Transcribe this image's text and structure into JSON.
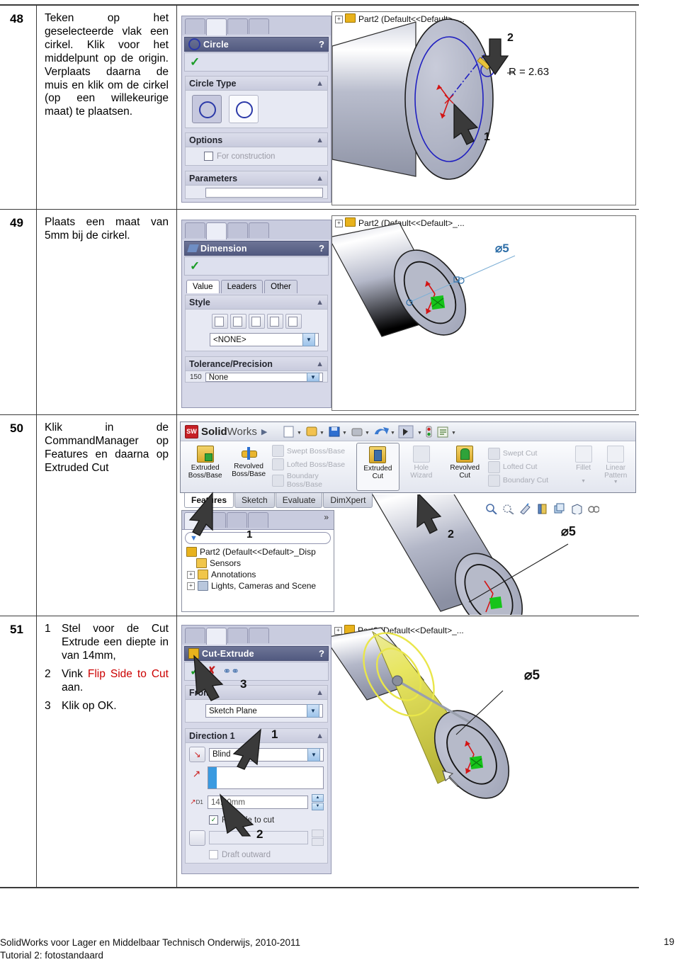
{
  "document": {
    "footer_line1": "SolidWorks voor Lager en Middelbaar Technisch Onderwijs, 2010-2011",
    "footer_line2": "Tutorial 2: fotostandaard",
    "page_number": "19"
  },
  "colors": {
    "accent_red": "#cc0000",
    "panel_title": "#5a6288",
    "dimension_blue": "#2f6fa8",
    "highlight_yellow": "#e9e64a"
  },
  "steps": [
    {
      "number": "48",
      "text": "Teken op het geselecteerde vlak een cirkel. Klik voor het middelpunt op de origin. Verplaats daarna de muis en klik om de cirkel (op een willekeurige maat) te plaatsen.",
      "panel": {
        "title": "Circle",
        "help": "?",
        "groups": [
          {
            "label": "Circle Type"
          },
          {
            "label": "Options",
            "checkbox": "For construction"
          },
          {
            "label": "Parameters"
          }
        ]
      },
      "viewport": {
        "tree_label": "Part2  (Default<<Default>_...",
        "annotations": [
          "1",
          "2"
        ],
        "radius_label": "R = 2.63"
      }
    },
    {
      "number": "49",
      "text": "Plaats een maat van 5mm bij de cirkel.",
      "panel": {
        "title": "Dimension",
        "help": "?",
        "tabs": [
          "Value",
          "Leaders",
          "Other"
        ],
        "groups": [
          {
            "label": "Style",
            "select_value": "<NONE>"
          },
          {
            "label": "Tolerance/Precision",
            "select_value": "None",
            "prefix": "150"
          }
        ]
      },
      "viewport": {
        "tree_label": "Part2  (Default<<Default>_...",
        "dimension_label": "⌀5"
      }
    },
    {
      "number": "50",
      "text": "Klik in de CommandManager op Features en daarna op Extruded Cut",
      "ribbon": {
        "brand": "SolidWorks",
        "brand_bold": "Solid",
        "brand_light": "Works",
        "logo_text": "SW",
        "buttons": [
          {
            "label": "Extruded\nBoss/Base",
            "enabled": true
          },
          {
            "label": "Revolved\nBoss/Base",
            "enabled": true
          },
          {
            "label": "Extruded\nCut",
            "enabled": true,
            "selected": true
          },
          {
            "label": "Hole\nWizard",
            "enabled": false
          },
          {
            "label": "Revolved\nCut",
            "enabled": true
          },
          {
            "label": "Fillet",
            "enabled": false
          },
          {
            "label": "Linear\nPattern",
            "enabled": false
          }
        ],
        "small_buttons_left": [
          "Swept Boss/Base",
          "Lofted Boss/Base",
          "Boundary Boss/Base"
        ],
        "small_buttons_right": [
          "Swept Cut",
          "Lofted Cut",
          "Boundary Cut"
        ],
        "tabs": [
          "Features",
          "Sketch",
          "Evaluate",
          "DimXpert"
        ],
        "active_tab": "Features"
      },
      "tree": {
        "root": "Part2  (Default<<Default>_Disp",
        "items": [
          "Sensors",
          "Annotations",
          "Lights, Cameras and Scene"
        ],
        "overflow": "»"
      },
      "viewport": {
        "annotations": [
          "1",
          "2"
        ],
        "dimension_label": "⌀5"
      }
    },
    {
      "number": "51",
      "substeps": [
        {
          "n": "1",
          "text": "Stel voor de Cut Extrude een diepte in van 14mm,"
        },
        {
          "n": "2",
          "text_before": "Vink ",
          "text_red": "Flip Side to Cut",
          "text_after": " aan."
        },
        {
          "n": "3",
          "text": "Klik op OK."
        }
      ],
      "panel": {
        "title": "Cut-Extrude",
        "help": "?",
        "from_group": "From",
        "from_value": "Sketch Plane",
        "direction_group": "Direction 1",
        "end_condition": "Blind",
        "depth_value": "14.00mm",
        "depth_field_label": "D1",
        "flip_checkbox": "Flip side to cut",
        "flip_checked": true,
        "draft_checkbox": "Draft outward",
        "annotations": [
          "1",
          "2",
          "3"
        ]
      },
      "viewport": {
        "tree_label": "Part2 (Default<<Default>_...",
        "dimension_label": "⌀5"
      }
    }
  ]
}
